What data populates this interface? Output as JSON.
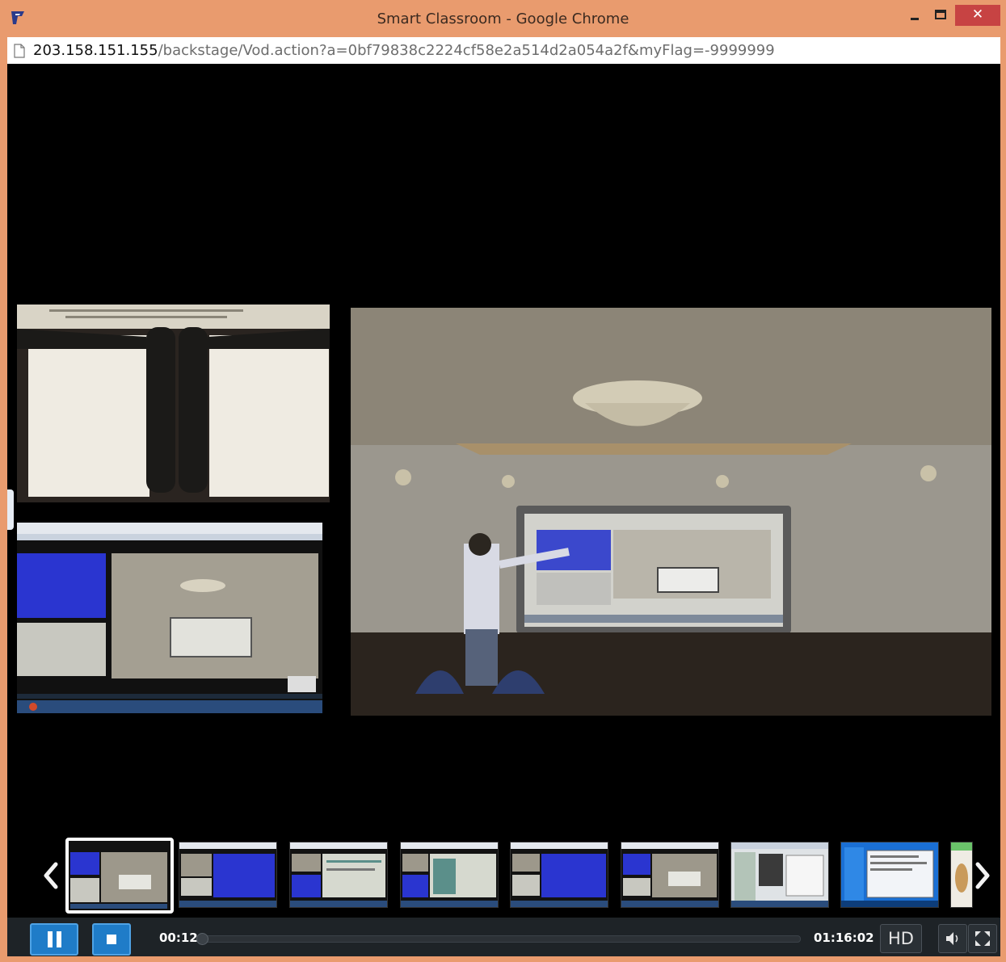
{
  "window": {
    "title": "Smart Classroom - Google Chrome",
    "minimize_icon": "minimize-icon",
    "maximize_icon": "maximize-icon",
    "close_icon": "close-icon",
    "close_label": "✕"
  },
  "address": {
    "host": "203.158.151.155",
    "path": "/backstage/Vod.action?a=0bf79838c2224cf58e2a514d2a054a2f&myFlag=-9999999"
  },
  "player": {
    "current_time": "00:12",
    "total_time": "01:16:02",
    "progress_fraction": 0.003,
    "hd_label": "HD",
    "thumbnail_count_visible": 9,
    "selected_thumbnail": 1
  },
  "colors": {
    "frame": "#e99b6e",
    "close_button": "#c74343",
    "control_bar": "#1e2327",
    "accent_blue": "#1f7cc8",
    "slide_blue": "#2a35d0"
  }
}
